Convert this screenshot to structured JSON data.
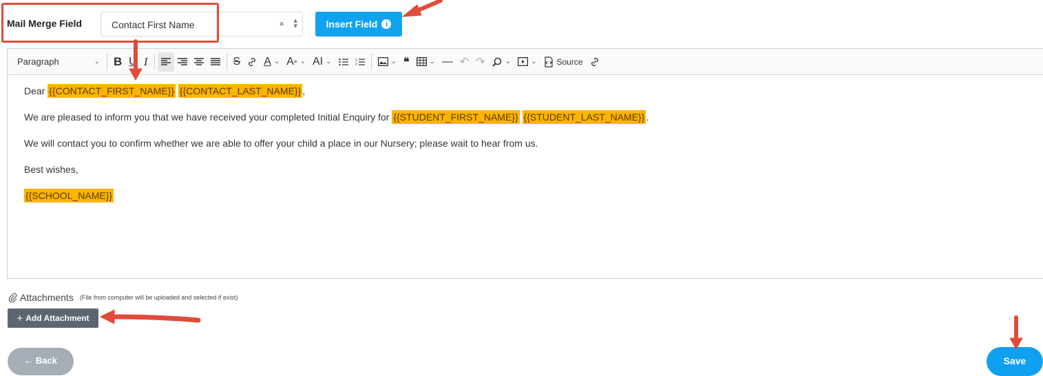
{
  "merge": {
    "label": "Mail Merge Field",
    "selected_value": "Contact First Name",
    "clear_glyph": "×",
    "updown_glyph": "⬍",
    "insert_button_label": "Insert Field",
    "insert_info_glyph": "i"
  },
  "toolbar": {
    "paragraph_label": "Paragraph",
    "bold": "B",
    "underline": "U",
    "italic": "I",
    "font_color": "A",
    "font_size": "A",
    "font_family": "AI",
    "blockquote": "❝",
    "horizontal_line": "—",
    "undo": "↶",
    "redo": "↷",
    "source_label": "Source",
    "icons": [
      "paragraph-dropdown",
      "bold-icon",
      "underline-icon",
      "italic-icon",
      "align-left-icon",
      "align-right-icon",
      "align-center-icon",
      "align-justify-icon",
      "strikethrough-icon",
      "link-icon",
      "font-color-icon",
      "font-size-icon",
      "font-family-icon",
      "bulleted-list-icon",
      "numbered-list-icon",
      "image-icon",
      "blockquote-icon",
      "table-icon",
      "horizontal-line-icon",
      "undo-icon",
      "redo-icon",
      "find-replace-icon",
      "media-embed-icon",
      "source-icon",
      "link-icon"
    ]
  },
  "content": {
    "greeting_prefix": "Dear ",
    "tag_contact_first": "{{CONTACT_FIRST_NAME}}",
    "tag_contact_last": "{{CONTACT_LAST_NAME}}",
    "greeting_suffix": ",",
    "line2_text": "We are pleased to inform you that we have received your completed Initial Enquiry for ",
    "tag_student_first": "{{STUDENT_FIRST_NAME}}",
    "tag_student_last": "{{STUDENT_LAST_NAME}}",
    "line2_suffix": ".",
    "line3_text": "We will contact you to confirm whether we are able to offer your child a place in our Nursery; please wait to hear from us.",
    "line4_text": "Best wishes,",
    "tag_school": "{{SCHOOL_NAME}}"
  },
  "attachments": {
    "label": "Attachments",
    "note": "(File from computer will be uploaded and selected if exist)",
    "add_button_label": "Add Attachment",
    "add_plus": "+"
  },
  "footer": {
    "back_label": "← Back",
    "save_label": "Save"
  },
  "colors": {
    "primary": "#11a3f0",
    "tag_highlight": "#fbb400",
    "annotation": "#e04b3b",
    "attach_button": "#5d6670",
    "back_button": "#a5aeb6"
  }
}
